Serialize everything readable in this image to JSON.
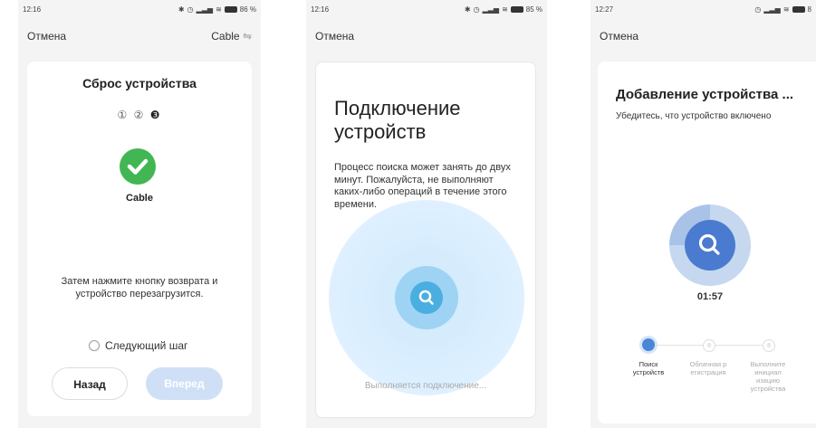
{
  "screen1": {
    "time": "12:16",
    "battery": "86 %",
    "cancel": "Отмена",
    "cable_label": "Cable",
    "title": "Сброс устройства",
    "steps": [
      "①",
      "②",
      "❸"
    ],
    "device_name": "Cable",
    "instruction": "Затем нажмите кнопку возврата и устройство перезагрузится.",
    "next_step": "Следующий шаг",
    "back": "Назад",
    "forward": "Вперед"
  },
  "screen2": {
    "time": "12:16",
    "battery": "85 %",
    "cancel": "Отмена",
    "title": "Подключение устройств",
    "description": "Процесс поиска может занять до двух минут. Пожалуйста, не выполняют каких-либо операций в течение этого времени.",
    "status": "Выполняется подключение..."
  },
  "screen3": {
    "time": "12:27",
    "battery": "8",
    "cancel": "Отмена",
    "title": "Добавление устройства ...",
    "subtitle": "Убедитесь, что устройство включено",
    "timer": "01:57",
    "steps": [
      {
        "label": "Поиск устройств"
      },
      {
        "label": "Облачная р егистрация"
      },
      {
        "label": "Выполните инициал изацию устройства"
      }
    ]
  },
  "colors": {
    "accent_blue": "#4a86d8",
    "success_green": "#42b653",
    "light_blue": "#dcefff",
    "scan_blue": "#4aaee0",
    "disabled_button": "#cfe0f6"
  }
}
